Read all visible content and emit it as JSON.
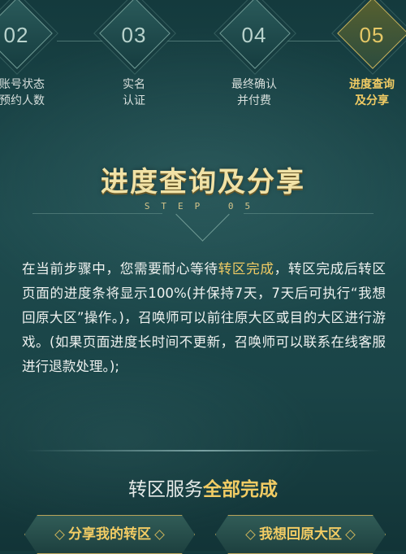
{
  "steps": [
    {
      "num": "02",
      "label_line1": "刚账号状态",
      "label_line2": "前预约人数"
    },
    {
      "num": "03",
      "label_line1": "实名",
      "label_line2": "认证"
    },
    {
      "num": "04",
      "label_line1": "最终确认",
      "label_line2": "并付费"
    },
    {
      "num": "05",
      "label_line1": "进度查询",
      "label_line2": "及分享"
    }
  ],
  "section": {
    "title": "进度查询及分享",
    "subtitle": "STEP 05"
  },
  "paragraph": {
    "part1": "在当前步骤中，您需要耐心等待",
    "highlight": "转区完成",
    "part2": "，转区完成后转区页面的进度条将显示100%(并保持7天，7天后可执行“我想回原大区”操作。)，召唤师可以前往原大区或目的大区进行游戏。(如果页面进度长时间不更新，召唤师可以联系在线客服进行退款处理。);"
  },
  "completion": {
    "prefix": "转区服务",
    "strong": "全部完成"
  },
  "buttons": {
    "share": "分享我的转区",
    "return": "我想回原大区"
  },
  "colors": {
    "accent_gold": "#f2cc64",
    "background": "#1d4a4d"
  }
}
